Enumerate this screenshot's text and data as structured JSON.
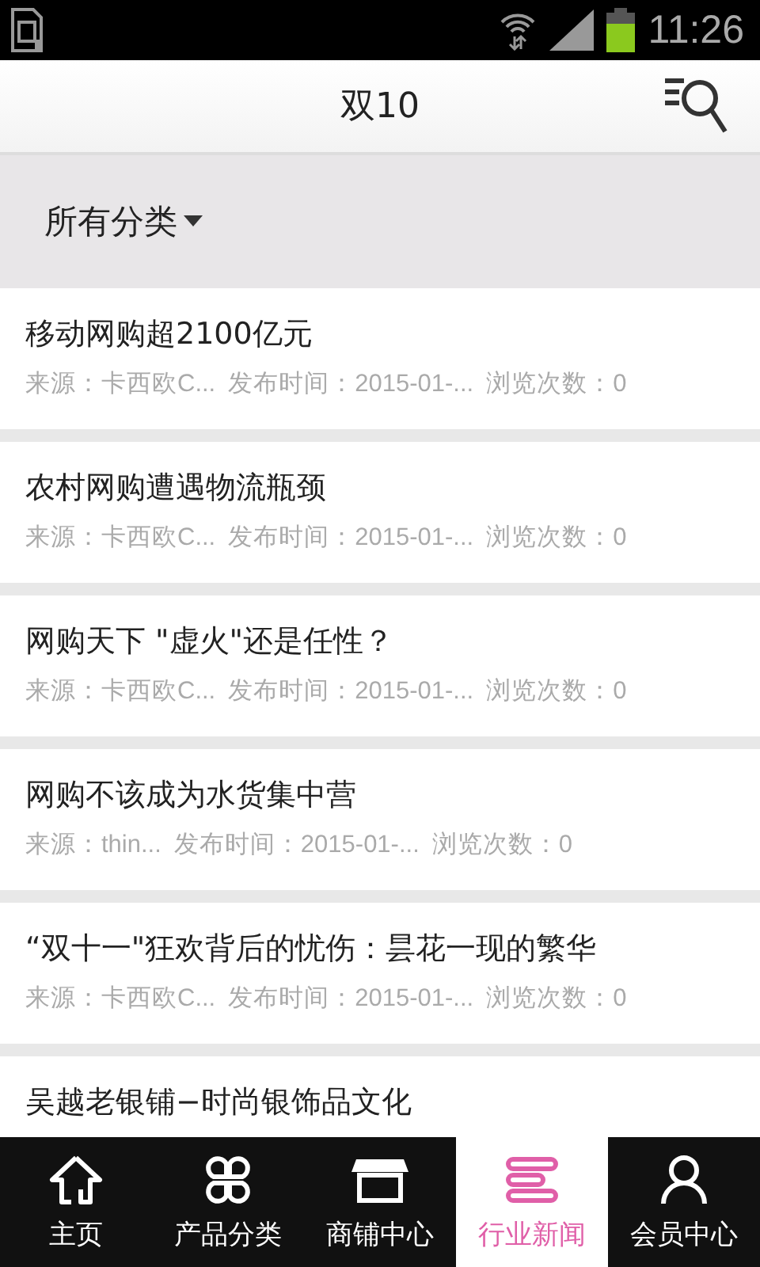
{
  "status_bar": {
    "time": "11:26"
  },
  "header": {
    "title": "双10"
  },
  "filter": {
    "label": "所有分类"
  },
  "articles": [
    {
      "title": "移动网购超2100亿元",
      "source": "来源：卡西欧C...",
      "date": "发布时间：2015-01-...",
      "views": "浏览次数：0"
    },
    {
      "title": "农村网购遭遇物流瓶颈",
      "source": "来源：卡西欧C...",
      "date": "发布时间：2015-01-...",
      "views": "浏览次数：0"
    },
    {
      "title": "网购天下 \"虚火\"还是任性？",
      "source": "来源：卡西欧C...",
      "date": "发布时间：2015-01-...",
      "views": "浏览次数：0"
    },
    {
      "title": "网购不该成为水货集中营",
      "source": "来源：thin...",
      "date": "发布时间：2015-01-...",
      "views": "浏览次数：0"
    },
    {
      "title": "“双十一\"狂欢背后的忧伤：昙花一现的繁华",
      "source": "来源：卡西欧C...",
      "date": "发布时间：2015-01-...",
      "views": "浏览次数：0"
    },
    {
      "title": "吴越老银铺−时尚银饰品文化"
    }
  ],
  "nav": [
    {
      "label": "主页",
      "selected": false
    },
    {
      "label": "产品分类",
      "selected": false
    },
    {
      "label": "商铺中心",
      "selected": false
    },
    {
      "label": "行业新闻",
      "selected": true
    },
    {
      "label": "会员中心",
      "selected": false
    }
  ]
}
